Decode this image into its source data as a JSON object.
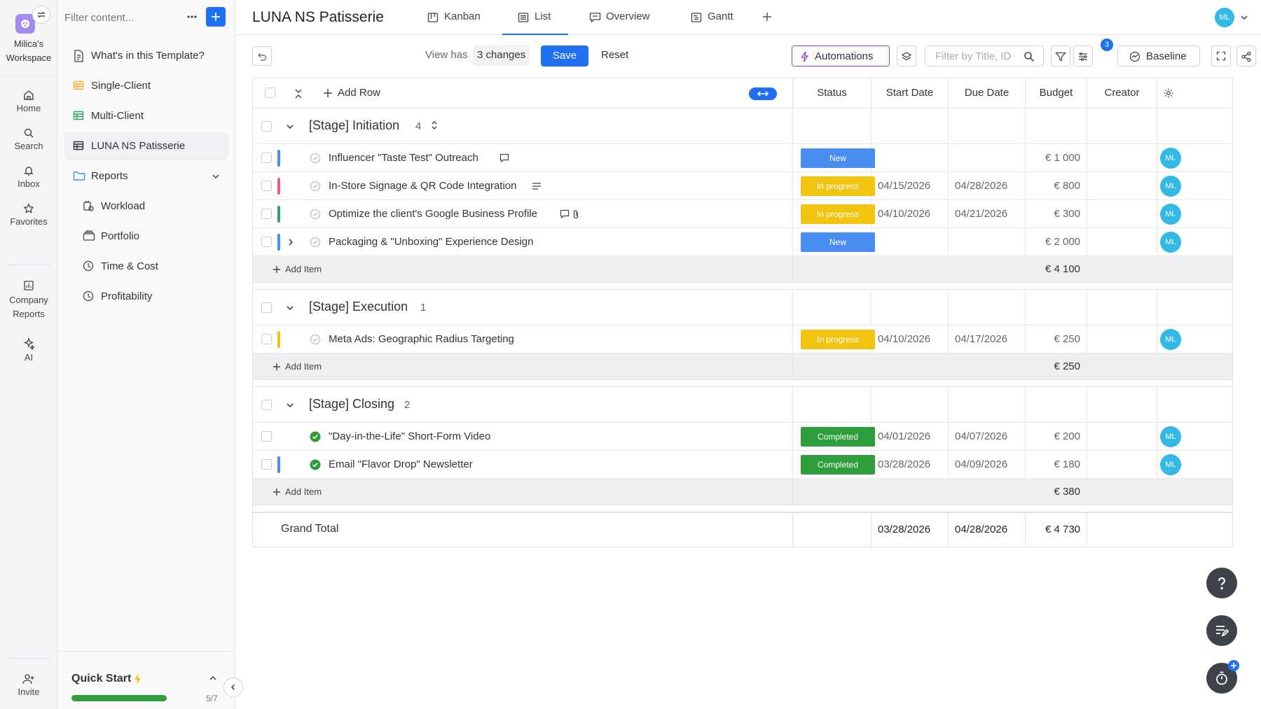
{
  "workspace": {
    "name_line1": "Milica's",
    "name_line2": "Workspace"
  },
  "rail": {
    "home": "Home",
    "search": "Search",
    "inbox": "Inbox",
    "favorites": "Favorites",
    "company_reports_1": "Company",
    "company_reports_2": "Reports",
    "ai": "AI",
    "invite": "Invite"
  },
  "sidebar": {
    "filter_placeholder": "Filter content...",
    "items": [
      {
        "label": "What's in this Template?"
      },
      {
        "label": "Single-Client"
      },
      {
        "label": "Multi-Client"
      },
      {
        "label": "LUNA NS Patisserie"
      },
      {
        "label": "Reports"
      },
      {
        "label": "Workload"
      },
      {
        "label": "Portfolio"
      },
      {
        "label": "Time & Cost"
      },
      {
        "label": "Profitability"
      }
    ],
    "quick_start": {
      "label": "Quick Start",
      "progress": "5/7",
      "fraction": 0.714
    }
  },
  "header": {
    "title": "LUNA NS Patisserie",
    "tabs": [
      {
        "label": "Kanban"
      },
      {
        "label": "List"
      },
      {
        "label": "Overview"
      },
      {
        "label": "Gantt"
      }
    ],
    "avatar": "ML"
  },
  "toolbar": {
    "view_has": "View has",
    "changes": "3 changes",
    "save": "Save",
    "reset": "Reset",
    "automations": "Automations",
    "search_placeholder": "Filter by Title, ID",
    "badge": "3",
    "baseline": "Baseline"
  },
  "grid": {
    "add_row": "Add Row",
    "columns": {
      "status": "Status",
      "start": "Start Date",
      "due": "Due Date",
      "budget": "Budget",
      "creator": "Creator"
    },
    "add_item": "Add Item",
    "groups": [
      {
        "name": "[Stage] Initiation",
        "count": "4",
        "subtotal": "€ 4 100",
        "tasks": [
          {
            "name": "Influencer \"Taste Test\" Outreach",
            "status": "New",
            "start": "",
            "due": "",
            "budget": "€ 1 000",
            "creator": "ML"
          },
          {
            "name": "In-Store Signage & QR Code Integration",
            "status": "In progress",
            "start": "04/15/2026",
            "due": "04/28/2026",
            "budget": "€ 800",
            "creator": "ML"
          },
          {
            "name": "Optimize the client's Google Business Profile",
            "status": "In progress",
            "start": "04/10/2026",
            "due": "04/21/2026",
            "budget": "€ 300",
            "creator": "ML"
          },
          {
            "name": "Packaging & \"Unboxing\" Experience Design",
            "status": "New",
            "start": "",
            "due": "",
            "budget": "€ 2 000",
            "creator": "ML"
          }
        ]
      },
      {
        "name": "[Stage] Execution",
        "count": "1",
        "subtotal": "€ 250",
        "tasks": [
          {
            "name": "Meta Ads: Geographic Radius Targeting",
            "status": "In progress",
            "start": "04/10/2026",
            "due": "04/17/2026",
            "budget": "€ 250",
            "creator": "ML"
          }
        ]
      },
      {
        "name": "[Stage] Closing",
        "count": "2",
        "subtotal": "€ 380",
        "tasks": [
          {
            "name": "\"Day-in-the-Life\" Short-Form Video",
            "status": "Completed",
            "start": "04/01/2026",
            "due": "04/07/2026",
            "budget": "€ 200",
            "creator": "ML"
          },
          {
            "name": "Email \"Flavor Drop\" Newsletter",
            "status": "Completed",
            "start": "03/28/2026",
            "due": "04/09/2026",
            "budget": "€ 180",
            "creator": "ML"
          }
        ]
      }
    ],
    "grand_total": {
      "label": "Grand Total",
      "start": "03/28/2026",
      "due": "04/28/2026",
      "budget": "€ 4 730"
    }
  },
  "colors": {
    "accent": "#1f6ff2",
    "status_new": "#4a8df0",
    "status_in_progress": "#f2c40f",
    "status_completed": "#2e9e3d",
    "avatar": "#32b9e6",
    "automations_border": "#8a4fd8"
  }
}
